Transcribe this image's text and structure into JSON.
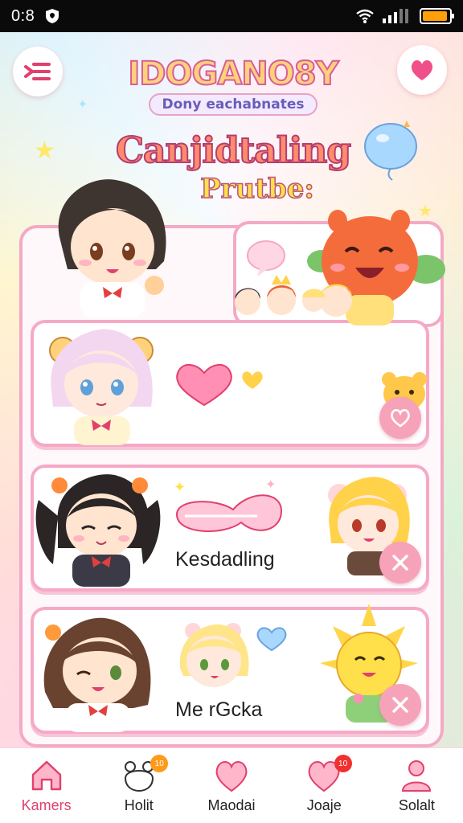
{
  "status_bar": {
    "time": "0:8",
    "battery_level": 0.95,
    "battery_color": "#ff9f0a",
    "icons": [
      "shield-icon",
      "wifi-icon",
      "signal-icon",
      "battery-icon"
    ]
  },
  "header": {
    "menu_icon": "menu-icon",
    "favorite_icon": "heart-icon",
    "logo_text": "IDOGANO8Y",
    "logo_subtitle": "Dony eachabnates",
    "headline": "Canjidtaling",
    "subheadline": "Prutbe:"
  },
  "cards": [
    {
      "label": "",
      "action_icon": "heart-icon"
    },
    {
      "label": "Kesdadling",
      "action_icon": "close-icon"
    },
    {
      "label": "Me rGcka",
      "action_icon": "close-icon"
    }
  ],
  "bottom_nav": [
    {
      "label": "Kamers",
      "icon": "home-icon",
      "active": true,
      "badge": ""
    },
    {
      "label": "Holit",
      "icon": "bear-icon",
      "active": false,
      "badge": "10"
    },
    {
      "label": "Maodai",
      "icon": "heart-icon",
      "active": false,
      "badge": ""
    },
    {
      "label": "Joaje",
      "icon": "heart-icon",
      "active": false,
      "badge": "10"
    },
    {
      "label": "Solalt",
      "icon": "person-icon",
      "active": false,
      "badge": ""
    }
  ],
  "colors": {
    "accent": "#e2406c",
    "card_border": "#f6a9c6",
    "action_button": "#f6a3b9",
    "badge_orange": "#ff9a1a",
    "badge_red": "#f0312f"
  }
}
